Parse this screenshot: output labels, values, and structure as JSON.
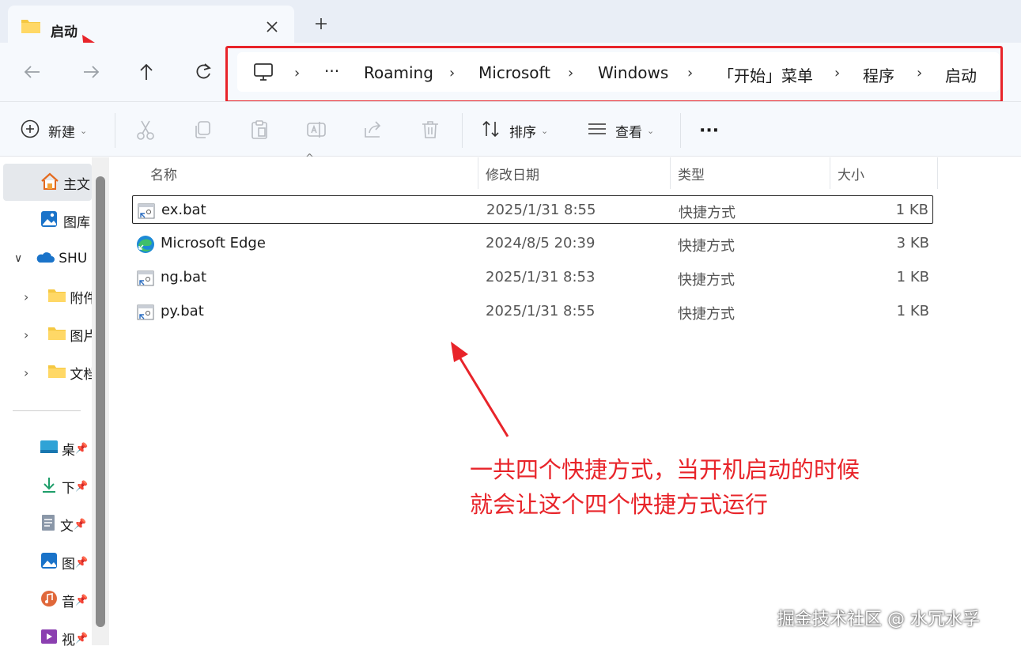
{
  "tab": {
    "title": "启动",
    "close": "×",
    "new_tab": "+"
  },
  "address": {
    "more": "···",
    "crumbs": [
      "Roaming",
      "Microsoft",
      "Windows",
      "「开始」菜单",
      "程序",
      "启动"
    ]
  },
  "commands": {
    "new_label": "新建",
    "sort_label": "排序",
    "view_label": "查看",
    "more": "···"
  },
  "sidebar": {
    "items": [
      {
        "label": "主文"
      },
      {
        "label": "图库"
      },
      {
        "label": "SHU"
      },
      {
        "label": "附件"
      },
      {
        "label": "图片"
      },
      {
        "label": "文档"
      },
      {
        "label": "桌"
      },
      {
        "label": "下"
      },
      {
        "label": "文"
      },
      {
        "label": "图"
      },
      {
        "label": "音"
      },
      {
        "label": "视"
      }
    ]
  },
  "columns": {
    "name": "名称",
    "modified": "修改日期",
    "type": "类型",
    "size": "大小"
  },
  "files": [
    {
      "name": "ex.bat",
      "modified": "2025/1/31 8:55",
      "type": "快捷方式",
      "size": "1 KB"
    },
    {
      "name": "Microsoft Edge",
      "modified": "2024/8/5 20:39",
      "type": "快捷方式",
      "size": "3 KB"
    },
    {
      "name": "ng.bat",
      "modified": "2025/1/31 8:53",
      "type": "快捷方式",
      "size": "1 KB"
    },
    {
      "name": "py.bat",
      "modified": "2025/1/31 8:55",
      "type": "快捷方式",
      "size": "1 KB"
    }
  ],
  "annotation": {
    "line1": "一共四个快捷方式，当开机启动的时候",
    "line2": "就会让这个四个快捷方式运行"
  },
  "watermark": "掘金技术社区 @ 水冗水孚",
  "colors": {
    "annotation_red": "#e8242a",
    "folder_yellow": "#f5c842",
    "edge_blue": "#1d8ad6",
    "edge_green": "#3fbf6a"
  }
}
